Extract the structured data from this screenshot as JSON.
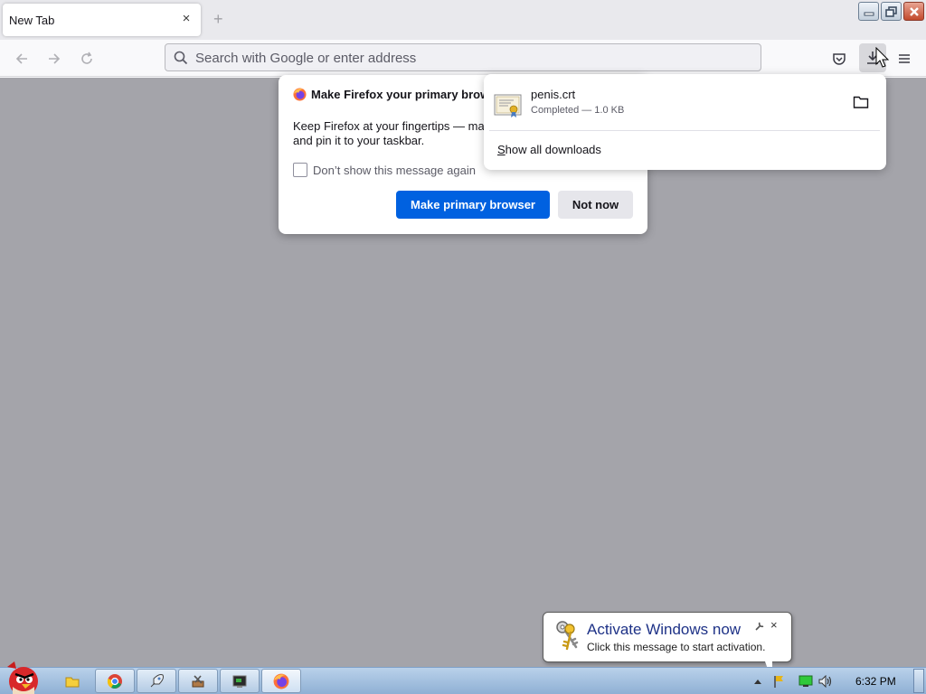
{
  "browser": {
    "tab_title": "New Tab",
    "tab_close": "×",
    "new_tab": "+",
    "search_placeholder": "Search with Google or enter address"
  },
  "dialog": {
    "title": "Make Firefox your primary brow",
    "body_line1": "Keep Firefox at your fingertips — ma",
    "body_line2": "and pin it to your taskbar.",
    "checkbox_label": "Don’t show this message again",
    "checkbox_checked": false,
    "primary_button": "Make primary browser",
    "secondary_button": "Not now"
  },
  "downloads": {
    "file_name": "penis.crt",
    "status": "Completed — 1.0 KB",
    "show_all_prefix": "S",
    "show_all_rest": "how all downloads"
  },
  "activation": {
    "title": "Activate Windows now",
    "subtitle": "Click this message to start activation.",
    "close": "×"
  },
  "taskbar": {
    "clock": "6:32 PM",
    "accent": "#0061e0"
  }
}
